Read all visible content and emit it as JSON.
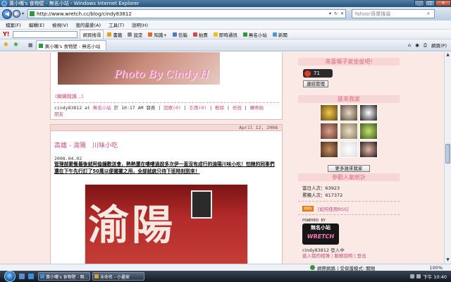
{
  "window": {
    "title": "黃小嘴's 食物壁 - 無名小站 - Windows Internet Explorer"
  },
  "address": {
    "url": "http://www.wretch.cc/blog/cindy83812",
    "search_placeholder": "Yahoo!奇摩搜尋"
  },
  "menu": [
    "檔案(F)",
    "編輯(E)",
    "檢視(V)",
    "我的最愛(A)",
    "工具(T)",
    "說明(H)"
  ],
  "toolbar": {
    "logo": "Y!",
    "search_btn": "網頁搜尋",
    "items": [
      "書籤",
      "設定",
      "知識+",
      "信箱",
      "拍賣",
      "即時通訊",
      "無名小站",
      "新聞"
    ]
  },
  "tab": {
    "label": "黃小嘴's 食物壁 - 無名小站"
  },
  "tab_tools": {
    "page": "網頁(P)"
  },
  "post1": {
    "photo_credit": "Photo By Cindy H",
    "read_more": "(繼續閱讀...)",
    "meta_author": "cindy83812 at ",
    "meta_site": "無名小站",
    "meta_time": " 於 10:17 AM 發表 | ",
    "meta_reply": "回應(0)",
    "meta_sep1": " | ",
    "meta_trackback": "引用(0)",
    "meta_sep2": " | ",
    "meta_delete": "刪除",
    "meta_sep3": " | ",
    "meta_edit": "修改",
    "meta_sep4": " | ",
    "meta_recommend": "轉寄給",
    "meta_friend": "朋友"
  },
  "post2": {
    "date_header": "April 12, 2008",
    "title": "高雄 - 渝陽　川味小吃",
    "date": "2008.04.02",
    "body": "管理部聚餐最後就阿倫鐘歡送會，熱熱還在嘍嘍過說多次伊一直沒有成行的渝陽川味小吃！怕辣的同事們還在下午先行訂了50萬以便擺擺之用，全部就統只待下班時刻到來！",
    "photo_sign": "渝陽"
  },
  "sidebar": {
    "head1": "來喜嘴子家坐坐吧!",
    "counter": "71",
    "link_manage": "連結管理",
    "head2": "誰來我家",
    "more_visitors": "更多誰來我家",
    "head3": "參觀人氣統計",
    "today_label": "當日人次：",
    "today_value": "63923",
    "total_label": "累積人次：",
    "total_value": "617372",
    "rss_badge": "RSS",
    "rss_link": "[如何使用RSS]",
    "powered_by": "POWERED BY",
    "logo_top": "無名小站",
    "logo_bottom": "WRETCH",
    "online": "cindy83812 登入中",
    "link1": "進入我的相簿",
    "link_sep": " | ",
    "link2": "服務說明",
    "link3": "登出"
  },
  "status": {
    "zone": "網際網路 | 受保護模式: 關閉",
    "zoom": "100%"
  },
  "taskbar": {
    "task1": "黃小嘴's 食物壁 - 無...",
    "task2": "未命名 - 小畫家",
    "clock": "下午 10:40"
  },
  "colors": {
    "page_bg": "#fbe9e6",
    "link": "#c64b7e",
    "sidebar_head": "#e4687a"
  }
}
